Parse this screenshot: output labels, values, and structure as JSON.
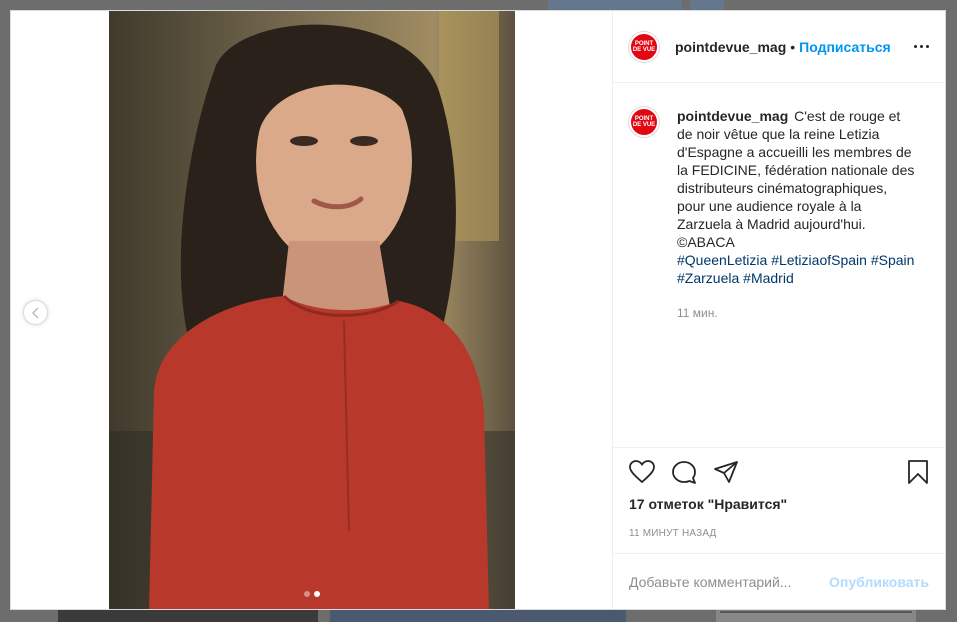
{
  "brand": {
    "accent": "#e30613",
    "link": "#0095f6",
    "avatar_text": "POINT DE VUE"
  },
  "header": {
    "username": "pointdevue_mag",
    "separator": "•",
    "follow_label": "Подписаться",
    "more_icon": "more-horizontal-icon"
  },
  "caption": {
    "username": "pointdevue_mag",
    "text": "C'est de rouge et de noir vêtue que la reine Letizia d'Espagne a accueilli les membres de la FEDICINE, fédération nationale des distributeurs cinématographiques, pour une audience royale à la Zarzuela à Madrid aujourd'hui. ©ABACA",
    "hashtags": [
      "#QueenLetizia",
      "#LetiziaofSpain",
      "#Spain",
      "#Zarzuela",
      "#Madrid"
    ],
    "time": "11 мин."
  },
  "actions": {
    "like_icon": "heart-icon",
    "comment_icon": "comment-icon",
    "share_icon": "share-icon",
    "save_icon": "bookmark-icon"
  },
  "likes_text": "17 отметок \"Нравится\"",
  "date_text": "11 МИНУТ НАЗАД",
  "comment_box": {
    "placeholder": "Добавьте комментарий...",
    "post_label": "Опубликовать"
  },
  "carousel": {
    "current": 2,
    "total": 2,
    "prev_icon": "chevron-left-icon"
  }
}
